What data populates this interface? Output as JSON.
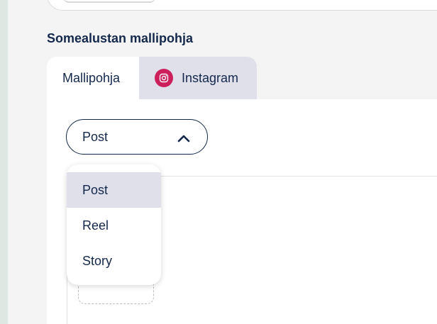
{
  "section": {
    "heading": "Somealustan mallipohja"
  },
  "tabs": [
    {
      "label": "Mallipohja",
      "active": true
    },
    {
      "label": "Instagram",
      "active": false,
      "icon": "instagram-icon"
    }
  ],
  "post_type_select": {
    "value": "Post",
    "expanded": true,
    "options": [
      {
        "label": "Post",
        "selected": true
      },
      {
        "label": "Reel",
        "selected": false
      },
      {
        "label": "Story",
        "selected": false
      }
    ]
  },
  "colors": {
    "text": "#14284b",
    "instagram_brand": "#cc1f5c",
    "highlight": "#dfe0ea"
  }
}
